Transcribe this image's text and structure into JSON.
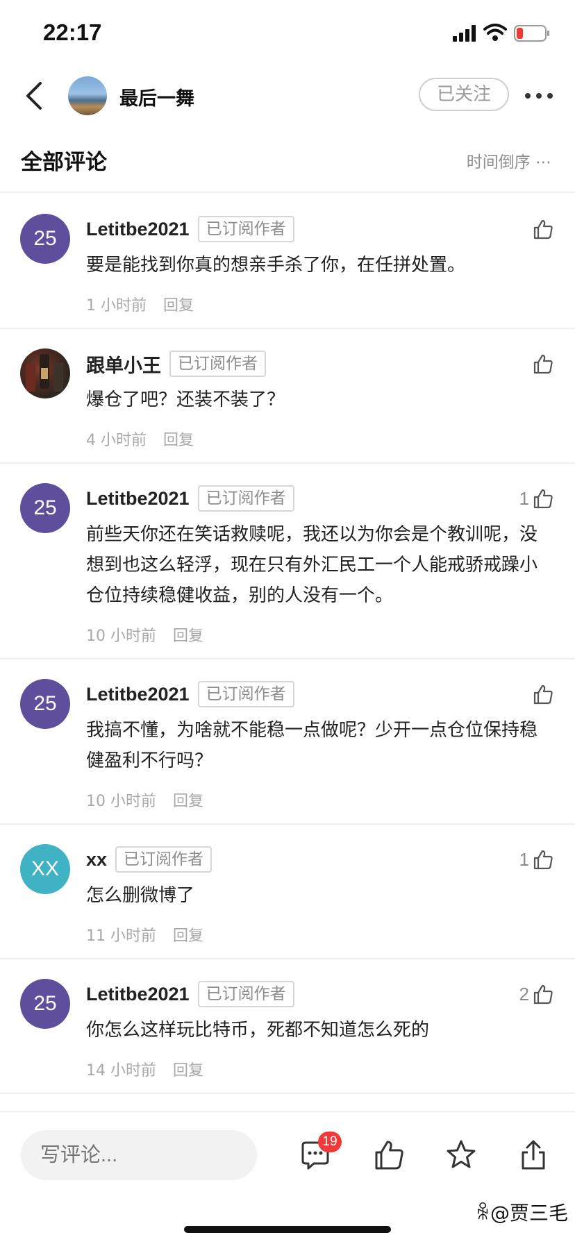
{
  "status_bar": {
    "time": "22:17"
  },
  "header": {
    "title": "最后一舞",
    "follow_label": "已关注"
  },
  "section": {
    "title": "全部评论",
    "sort_label": "时间倒序 ⋯"
  },
  "comments": [
    {
      "user": "Letitbe2021",
      "avatar_text": "25",
      "badge": "已订阅作者",
      "text": "要是能找到你真的想亲手杀了你，在任拼处置。",
      "time": "1 小时前",
      "reply": "回复",
      "likes": ""
    },
    {
      "user": "跟单小王",
      "avatar_text": "",
      "badge": "已订阅作者",
      "text": "爆仓了吧？还装不装了？",
      "time": "4 小时前",
      "reply": "回复",
      "likes": ""
    },
    {
      "user": "Letitbe2021",
      "avatar_text": "25",
      "badge": "已订阅作者",
      "text": "前些天你还在笑话救赎呢，我还以为你会是个教训呢，没想到也这么轻浮，现在只有外汇民工一个人能戒骄戒躁小仓位持续稳健收益，别的人没有一个。",
      "time": "10 小时前",
      "reply": "回复",
      "likes": "1"
    },
    {
      "user": "Letitbe2021",
      "avatar_text": "25",
      "badge": "已订阅作者",
      "text": "我搞不懂，为啥就不能稳一点做呢？少开一点仓位保持稳健盈利不行吗？",
      "time": "10 小时前",
      "reply": "回复",
      "likes": ""
    },
    {
      "user": "xx",
      "avatar_text": "XX",
      "badge": "已订阅作者",
      "text": "怎么删微博了",
      "time": "11 小时前",
      "reply": "回复",
      "likes": "1"
    },
    {
      "user": "Letitbe2021",
      "avatar_text": "25",
      "badge": "已订阅作者",
      "text": "你怎么这样玩比特币，死都不知道怎么死的",
      "time": "14 小时前",
      "reply": "回复",
      "likes": "2"
    }
  ],
  "bottom_bar": {
    "comment_placeholder": "写评论...",
    "comment_count_badge": "19",
    "watermark": "@贾三毛"
  },
  "icons": {
    "back": "chevron-left-icon",
    "more": "more-dots-icon",
    "like": "thumbs-up-icon",
    "comments": "comment-bubble-icon",
    "favorite": "star-icon",
    "share": "share-icon"
  },
  "colors": {
    "avatar_purple": "#5e4f9c",
    "avatar_teal": "#3fb2c4",
    "badge_red": "#f03a3a"
  }
}
